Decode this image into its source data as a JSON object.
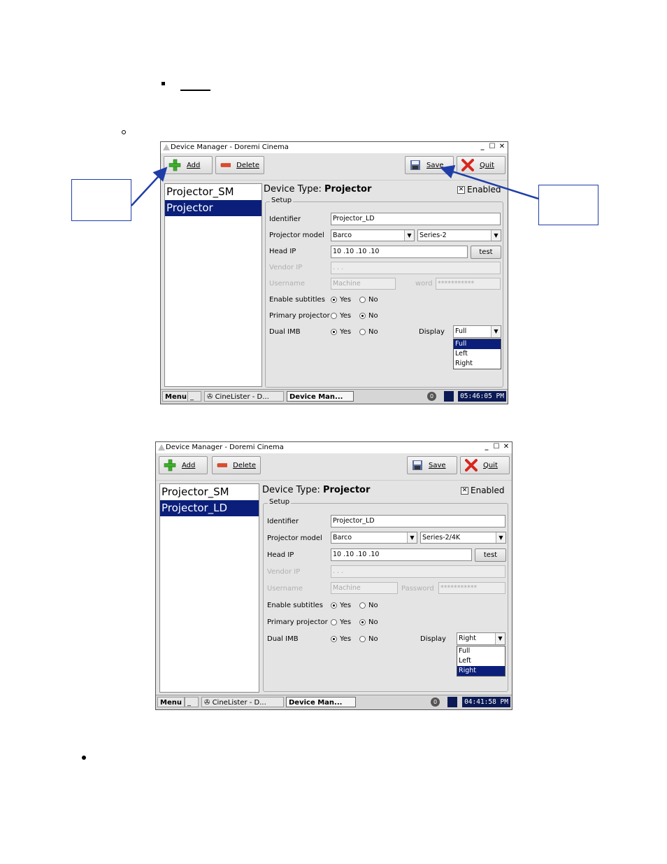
{
  "windows": [
    {
      "title": "Device Manager - Doremi Cinema",
      "toolbar": {
        "add": "Add",
        "delete": "Delete",
        "save": "Save",
        "quit": "Quit"
      },
      "devices": [
        "Projector_SM",
        "Projector"
      ],
      "selected_device_index": 1,
      "device_type_label": "Device Type:",
      "device_type": "Projector",
      "enabled_label": "Enabled",
      "enabled_checked": true,
      "setup_label": "Setup",
      "fields": {
        "identifier_label": "Identifier",
        "identifier": "Projector_LD",
        "model_label": "Projector model",
        "model": "Barco",
        "series": "Series-2",
        "head_ip_label": "Head IP",
        "head_ip": "10 .10 .10 .10",
        "test": "test",
        "vendor_ip_label": "Vendor IP",
        "vendor_ip": ". . .",
        "username_label": "Username",
        "username": "Machine",
        "password_label": "word",
        "password": "***********",
        "subtitles_label": "Enable subtitles",
        "primary_label": "Primary projector",
        "dual_label": "Dual IMB",
        "yes": "Yes",
        "no": "No",
        "display_label": "Display",
        "display_value": "Full"
      },
      "display_options": [
        "Full",
        "Left",
        "Right"
      ],
      "display_selected_index": 0,
      "taskbar": {
        "menu": "Menu",
        "min": "_",
        "cinelister": "CineLister - D...",
        "device_manager": "Device Man...",
        "power": "0",
        "clock": "05:46:05 PM"
      }
    },
    {
      "title": "Device Manager - Doremi Cinema",
      "toolbar": {
        "add": "Add",
        "delete": "Delete",
        "save": "Save",
        "quit": "Quit"
      },
      "devices": [
        "Projector_SM",
        "Projector_LD"
      ],
      "selected_device_index": 1,
      "device_type_label": "Device Type:",
      "device_type": "Projector",
      "enabled_label": "Enabled",
      "enabled_checked": true,
      "setup_label": "Setup",
      "fields": {
        "identifier_label": "Identifier",
        "identifier": "Projector_LD",
        "model_label": "Projector model",
        "model": "Barco",
        "series": "Series-2/4K",
        "head_ip_label": "Head IP",
        "head_ip": "10 .10 .10 .10",
        "test": "test",
        "vendor_ip_label": "Vendor IP",
        "vendor_ip": ". . .",
        "username_label": "Username",
        "username": "Machine",
        "password_label": "Password",
        "password": "***********",
        "subtitles_label": "Enable subtitles",
        "primary_label": "Primary projector",
        "dual_label": "Dual IMB",
        "yes": "Yes",
        "no": "No",
        "display_label": "Display",
        "display_value": "Right"
      },
      "display_options": [
        "Full",
        "Left",
        "Right"
      ],
      "display_selected_index": 2,
      "taskbar": {
        "menu": "Menu",
        "min": "_",
        "cinelister": "CineLister - D...",
        "device_manager": "Device Man...",
        "power": "0",
        "clock": "04:41:58 PM"
      }
    }
  ],
  "icons": {
    "add": "plus-icon",
    "delete": "minus-icon",
    "save": "floppy-icon",
    "quit": "x-icon"
  },
  "colors": {
    "selection": "#0b1f7a",
    "callout_border": "#1f3da8",
    "arrow": "#1f3da8",
    "add_green": "#3dae2b",
    "delete_red": "#e04a2a"
  }
}
